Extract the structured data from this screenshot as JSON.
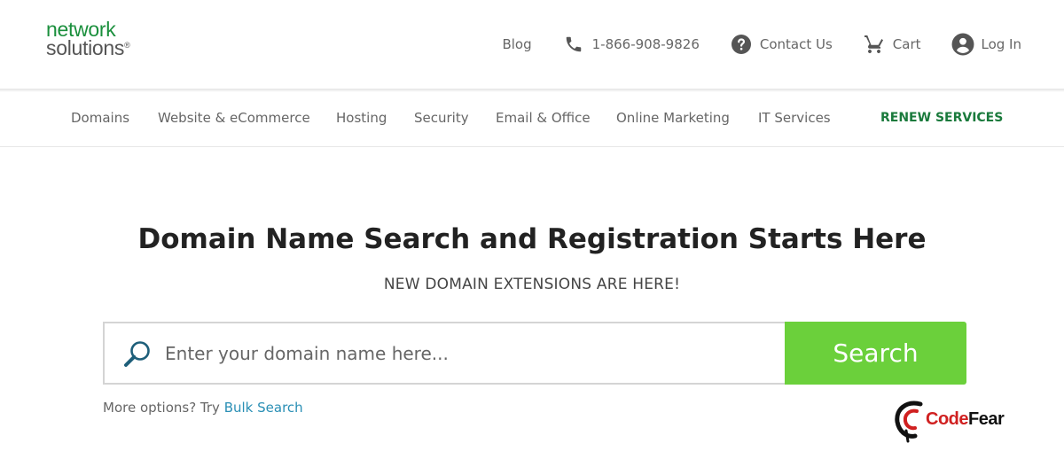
{
  "brand": {
    "line1": "network",
    "line2": "solutions",
    "reg": "®"
  },
  "top_links": {
    "blog": "Blog",
    "phone": "1-866-908-9826",
    "contact": "Contact Us",
    "cart": "Cart",
    "login": "Log In"
  },
  "nav": {
    "items": [
      "Domains",
      "Website & eCommerce",
      "Hosting",
      "Security",
      "Email & Office",
      "Online Marketing",
      "IT Services"
    ],
    "renew": "RENEW SERVICES"
  },
  "hero": {
    "title": "Domain Name Search and Registration Starts Here",
    "subtitle": "NEW DOMAIN EXTENSIONS ARE HERE!"
  },
  "search": {
    "placeholder": "Enter your domain name here...",
    "value": "",
    "button": "Search"
  },
  "more_options": {
    "text": "More options? Try ",
    "link": "Bulk Search"
  },
  "watermark": {
    "part1": "Code",
    "part2": "Fear"
  },
  "colors": {
    "brand_green": "#1a8f3c",
    "search_button": "#6bd03b",
    "link": "#2a8fb5",
    "renew": "#1a7a3c"
  },
  "icons": {
    "phone": "phone-icon",
    "contact": "help-circle-icon",
    "cart": "cart-icon",
    "login": "user-circle-icon",
    "search": "magnifier-icon"
  }
}
